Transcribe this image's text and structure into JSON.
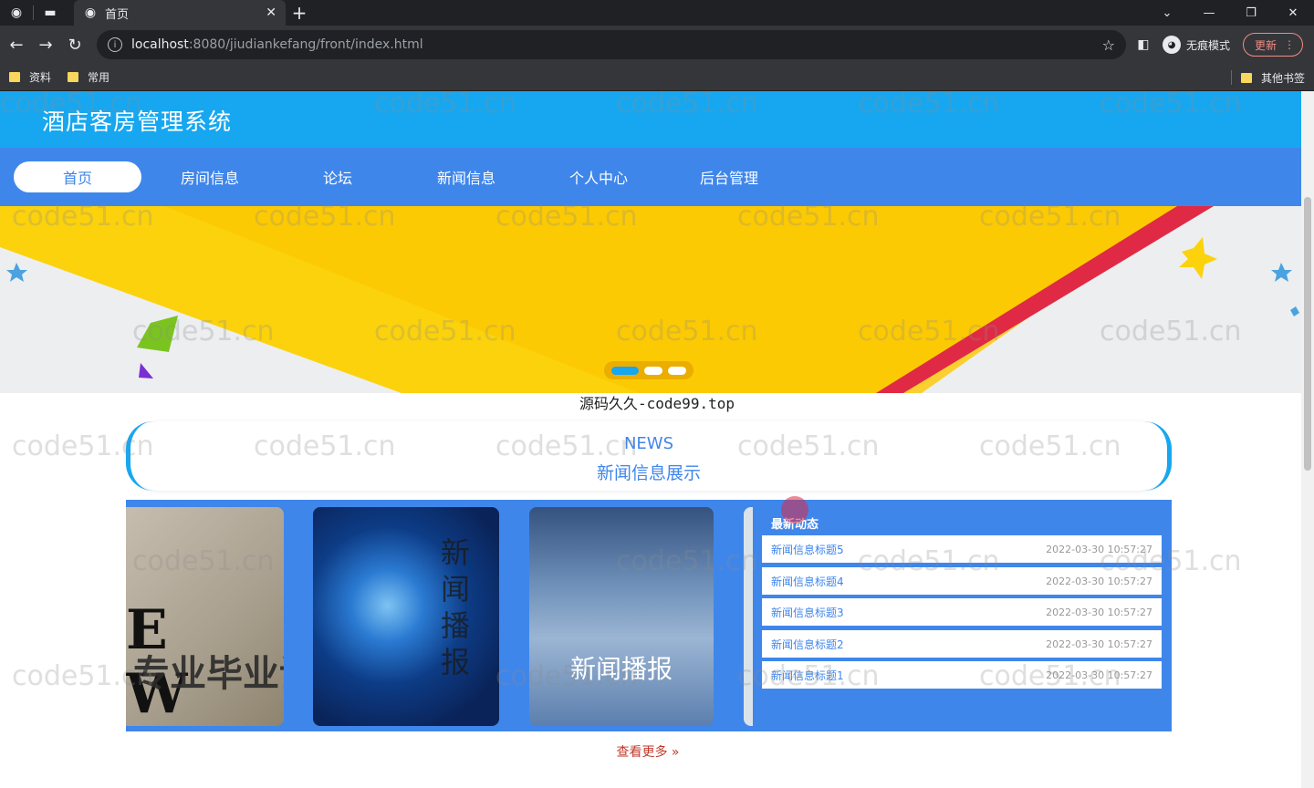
{
  "browser": {
    "tab_title": "首页",
    "url_host": "localhost",
    "url_rest": ":8080/jiudiankefang/front/index.html",
    "incognito_label": "无痕模式",
    "update_label": "更新",
    "bookmarks": [
      "资料",
      "常用"
    ],
    "other_bookmarks": "其他书签"
  },
  "site": {
    "title": "酒店客房管理系统",
    "nav": [
      "首页",
      "房间信息",
      "论坛",
      "新闻信息",
      "个人中心",
      "后台管理"
    ],
    "active_nav": 0
  },
  "banner": {
    "slide_count": 3,
    "active_slide": 0
  },
  "source_line": "源码久久-code99.top",
  "news_section": {
    "title_en": "NEWS",
    "title_cn": "新闻信息展示",
    "thumb1_letters": "E W",
    "thumb1_overlay": "专业毕业设计代做报",
    "thumb2_vertical": "新闻播报",
    "thumb3_title": "新闻播报",
    "latest_title": "最新动态",
    "latest": [
      {
        "title": "新闻信息标题5",
        "date": "2022-03-30 10:57:27"
      },
      {
        "title": "新闻信息标题4",
        "date": "2022-03-30 10:57:27"
      },
      {
        "title": "新闻信息标题3",
        "date": "2022-03-30 10:57:27"
      },
      {
        "title": "新闻信息标题2",
        "date": "2022-03-30 10:57:27"
      },
      {
        "title": "新闻信息标题1",
        "date": "2022-03-30 10:57:27"
      }
    ],
    "more_label": "查看更多 »"
  },
  "watermark": "code51.cn",
  "colors": {
    "header": "#17a7f0",
    "nav": "#3f86eb",
    "accent": "#17a7f0"
  }
}
